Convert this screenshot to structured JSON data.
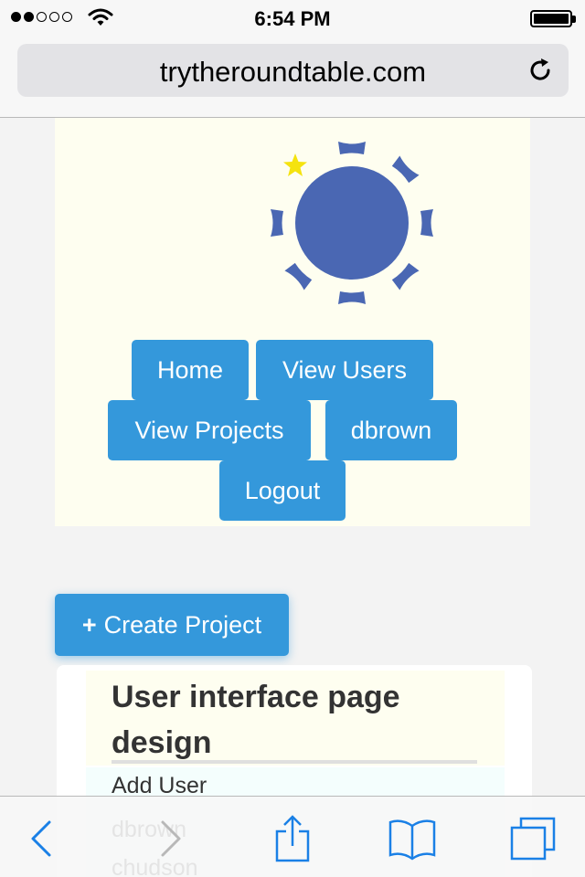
{
  "status_bar": {
    "time": "6:54 PM",
    "signal_bars_filled": 2,
    "signal_bars_total": 5,
    "battery_level": 1.0
  },
  "browser": {
    "url": "trytheroundtable.com"
  },
  "nav": {
    "home": "Home",
    "view_users": "View Users",
    "view_projects": "View Projects",
    "username": "dbrown",
    "logout": "Logout"
  },
  "actions": {
    "create_project_icon": "+",
    "create_project": "Create Project"
  },
  "project": {
    "title": "User interface page design",
    "items": [
      "Add User",
      "dbrown",
      "chudson"
    ]
  },
  "colors": {
    "accent": "#3498db",
    "logo": "#4a67b3",
    "star": "#f5e30e",
    "ios_tint": "#1a80e6"
  }
}
